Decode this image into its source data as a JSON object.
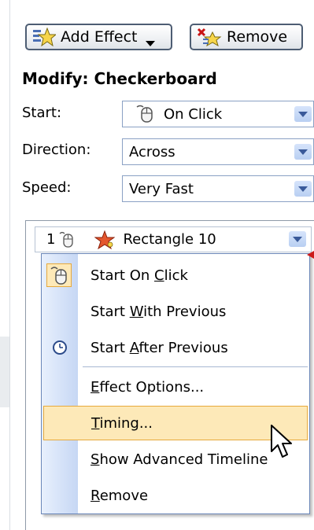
{
  "toolbar": {
    "add_effect_label": "Add Effect",
    "remove_label": "Remove"
  },
  "modify": {
    "title": "Modify: Checkerboard",
    "fields": [
      {
        "label": "Start:",
        "value": "On Click",
        "icon": "mouse-icon"
      },
      {
        "label": "Direction:",
        "value": "Across"
      },
      {
        "label": "Speed:",
        "value": "Very Fast"
      }
    ]
  },
  "effect_list": {
    "items": [
      {
        "number": "1",
        "trigger_icon": "mouse-icon",
        "effect_icon": "star-effect-icon",
        "name": "Rectangle 10"
      }
    ]
  },
  "context_menu": {
    "items": [
      {
        "pre": "Start On ",
        "ul": "C",
        "post": "lick",
        "icon": "mouse-icon",
        "checked": true
      },
      {
        "pre": "Start ",
        "ul": "W",
        "post": "ith Previous"
      },
      {
        "pre": "Start ",
        "ul": "A",
        "post": "fter Previous",
        "icon": "clock-icon"
      },
      {
        "pre": "",
        "ul": "E",
        "post": "ffect Options..."
      },
      {
        "pre": "",
        "ul": "T",
        "post": "iming...",
        "highlighted": true
      },
      {
        "pre": "",
        "ul": "S",
        "post": "how Advanced Timeline"
      },
      {
        "pre": "",
        "ul": "R",
        "post": "emove"
      }
    ]
  },
  "colors": {
    "menu_highlight": "#fde9b8",
    "menu_highlight_border": "#e7a93b",
    "dropdown_arrow": "#3a5a9a"
  }
}
